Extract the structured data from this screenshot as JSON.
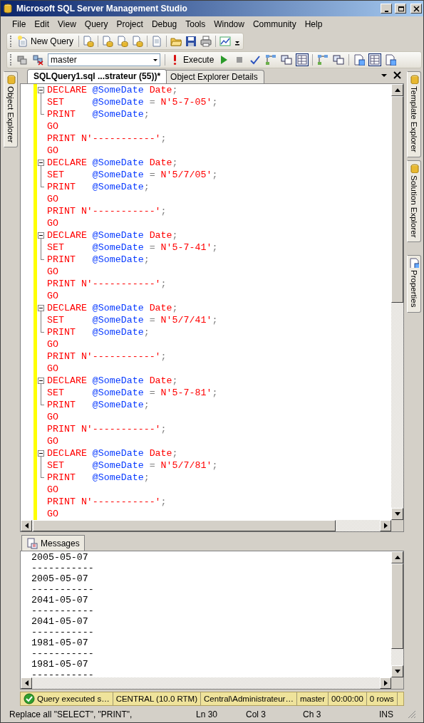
{
  "window": {
    "title": "Microsoft SQL Server Management Studio"
  },
  "menu": [
    "File",
    "Edit",
    "View",
    "Query",
    "Project",
    "Debug",
    "Tools",
    "Window",
    "Community",
    "Help"
  ],
  "toolbar": {
    "new_query": "New Query",
    "database": "master",
    "execute": "Execute"
  },
  "side_tabs_left": [
    "Object Explorer"
  ],
  "side_tabs_right": [
    "Template Explorer",
    "Solution Explorer",
    "Properties"
  ],
  "doc_tabs": [
    {
      "label": "SQLQuery1.sql ...strateur (55))*",
      "selected": true
    },
    {
      "label": "Object Explorer Details",
      "selected": false
    }
  ],
  "code_lines": [
    {
      "expanded": true,
      "tokens": [
        {
          "kind": "keyword",
          "text": "DECLARE "
        },
        {
          "kind": "variable",
          "text": "@SomeDate "
        },
        {
          "kind": "keyword",
          "text": "Date"
        },
        {
          "kind": "punct",
          "text": ";"
        }
      ],
      "children": [
        {
          "tokens": [
            {
              "kind": "keyword",
              "text": "SET     "
            },
            {
              "kind": "variable",
              "text": "@SomeDate "
            },
            {
              "kind": "punct",
              "text": "= "
            },
            {
              "kind": "string",
              "text": "N'5-7-05'"
            },
            {
              "kind": "punct",
              "text": ";"
            }
          ]
        },
        {
          "tokens": [
            {
              "kind": "keyword",
              "text": "PRINT   "
            },
            {
              "kind": "variable",
              "text": "@SomeDate"
            },
            {
              "kind": "punct",
              "text": ";"
            }
          ]
        }
      ]
    },
    {
      "tokens": [
        {
          "kind": "keyword",
          "text": "GO"
        }
      ]
    },
    {
      "tokens": [
        {
          "kind": "keyword",
          "text": "PRINT "
        },
        {
          "kind": "string",
          "text": "N'-----------'"
        },
        {
          "kind": "punct",
          "text": ";"
        }
      ]
    },
    {
      "tokens": [
        {
          "kind": "keyword",
          "text": "GO"
        }
      ]
    },
    {
      "expanded": true,
      "tokens": [
        {
          "kind": "keyword",
          "text": "DECLARE "
        },
        {
          "kind": "variable",
          "text": "@SomeDate "
        },
        {
          "kind": "keyword",
          "text": "Date"
        },
        {
          "kind": "punct",
          "text": ";"
        }
      ],
      "children": [
        {
          "tokens": [
            {
              "kind": "keyword",
              "text": "SET     "
            },
            {
              "kind": "variable",
              "text": "@SomeDate "
            },
            {
              "kind": "punct",
              "text": "= "
            },
            {
              "kind": "string",
              "text": "N'5/7/05'"
            },
            {
              "kind": "punct",
              "text": ";"
            }
          ]
        },
        {
          "tokens": [
            {
              "kind": "keyword",
              "text": "PRINT   "
            },
            {
              "kind": "variable",
              "text": "@SomeDate"
            },
            {
              "kind": "punct",
              "text": ";"
            }
          ]
        }
      ]
    },
    {
      "tokens": [
        {
          "kind": "keyword",
          "text": "GO"
        }
      ]
    },
    {
      "tokens": [
        {
          "kind": "keyword",
          "text": "PRINT "
        },
        {
          "kind": "string",
          "text": "N'-----------'"
        },
        {
          "kind": "punct",
          "text": ";"
        }
      ]
    },
    {
      "tokens": [
        {
          "kind": "keyword",
          "text": "GO"
        }
      ]
    },
    {
      "expanded": true,
      "tokens": [
        {
          "kind": "keyword",
          "text": "DECLARE "
        },
        {
          "kind": "variable",
          "text": "@SomeDate "
        },
        {
          "kind": "keyword",
          "text": "Date"
        },
        {
          "kind": "punct",
          "text": ";"
        }
      ],
      "children": [
        {
          "tokens": [
            {
              "kind": "keyword",
              "text": "SET     "
            },
            {
              "kind": "variable",
              "text": "@SomeDate "
            },
            {
              "kind": "punct",
              "text": "= "
            },
            {
              "kind": "string",
              "text": "N'5-7-41'"
            },
            {
              "kind": "punct",
              "text": ";"
            }
          ]
        },
        {
          "tokens": [
            {
              "kind": "keyword",
              "text": "PRINT   "
            },
            {
              "kind": "variable",
              "text": "@SomeDate"
            },
            {
              "kind": "punct",
              "text": ";"
            }
          ]
        }
      ]
    },
    {
      "tokens": [
        {
          "kind": "keyword",
          "text": "GO"
        }
      ]
    },
    {
      "tokens": [
        {
          "kind": "keyword",
          "text": "PRINT "
        },
        {
          "kind": "string",
          "text": "N'-----------'"
        },
        {
          "kind": "punct",
          "text": ";"
        }
      ]
    },
    {
      "tokens": [
        {
          "kind": "keyword",
          "text": "GO"
        }
      ]
    },
    {
      "expanded": true,
      "tokens": [
        {
          "kind": "keyword",
          "text": "DECLARE "
        },
        {
          "kind": "variable",
          "text": "@SomeDate "
        },
        {
          "kind": "keyword",
          "text": "Date"
        },
        {
          "kind": "punct",
          "text": ";"
        }
      ],
      "children": [
        {
          "tokens": [
            {
              "kind": "keyword",
              "text": "SET     "
            },
            {
              "kind": "variable",
              "text": "@SomeDate "
            },
            {
              "kind": "punct",
              "text": "= "
            },
            {
              "kind": "string",
              "text": "N'5/7/41'"
            },
            {
              "kind": "punct",
              "text": ";"
            }
          ]
        },
        {
          "tokens": [
            {
              "kind": "keyword",
              "text": "PRINT   "
            },
            {
              "kind": "variable",
              "text": "@SomeDate"
            },
            {
              "kind": "punct",
              "text": ";"
            }
          ]
        }
      ]
    },
    {
      "tokens": [
        {
          "kind": "keyword",
          "text": "GO"
        }
      ]
    },
    {
      "tokens": [
        {
          "kind": "keyword",
          "text": "PRINT "
        },
        {
          "kind": "string",
          "text": "N'-----------'"
        },
        {
          "kind": "punct",
          "text": ";"
        }
      ]
    },
    {
      "tokens": [
        {
          "kind": "keyword",
          "text": "GO"
        }
      ]
    },
    {
      "expanded": true,
      "tokens": [
        {
          "kind": "keyword",
          "text": "DECLARE "
        },
        {
          "kind": "variable",
          "text": "@SomeDate "
        },
        {
          "kind": "keyword",
          "text": "Date"
        },
        {
          "kind": "punct",
          "text": ";"
        }
      ],
      "children": [
        {
          "tokens": [
            {
              "kind": "keyword",
              "text": "SET     "
            },
            {
              "kind": "variable",
              "text": "@SomeDate "
            },
            {
              "kind": "punct",
              "text": "= "
            },
            {
              "kind": "string",
              "text": "N'5-7-81'"
            },
            {
              "kind": "punct",
              "text": ";"
            }
          ]
        },
        {
          "tokens": [
            {
              "kind": "keyword",
              "text": "PRINT   "
            },
            {
              "kind": "variable",
              "text": "@SomeDate"
            },
            {
              "kind": "punct",
              "text": ";"
            }
          ]
        }
      ]
    },
    {
      "tokens": [
        {
          "kind": "keyword",
          "text": "GO"
        }
      ]
    },
    {
      "tokens": [
        {
          "kind": "keyword",
          "text": "PRINT "
        },
        {
          "kind": "string",
          "text": "N'-----------'"
        },
        {
          "kind": "punct",
          "text": ";"
        }
      ]
    },
    {
      "tokens": [
        {
          "kind": "keyword",
          "text": "GO"
        }
      ]
    },
    {
      "expanded": true,
      "tokens": [
        {
          "kind": "keyword",
          "text": "DECLARE "
        },
        {
          "kind": "variable",
          "text": "@SomeDate "
        },
        {
          "kind": "keyword",
          "text": "Date"
        },
        {
          "kind": "punct",
          "text": ";"
        }
      ],
      "children": [
        {
          "tokens": [
            {
              "kind": "keyword",
              "text": "SET     "
            },
            {
              "kind": "variable",
              "text": "@SomeDate "
            },
            {
              "kind": "punct",
              "text": "= "
            },
            {
              "kind": "string",
              "text": "N'5/7/81'"
            },
            {
              "kind": "punct",
              "text": ";"
            }
          ]
        },
        {
          "tokens": [
            {
              "kind": "keyword",
              "text": "PRINT   "
            },
            {
              "kind": "variable",
              "text": "@SomeDate"
            },
            {
              "kind": "punct",
              "text": ";"
            }
          ]
        }
      ]
    },
    {
      "tokens": [
        {
          "kind": "keyword",
          "text": "GO"
        }
      ]
    },
    {
      "tokens": [
        {
          "kind": "keyword",
          "text": "PRINT "
        },
        {
          "kind": "string",
          "text": "N'-----------'"
        },
        {
          "kind": "punct",
          "text": ";"
        }
      ]
    },
    {
      "tokens": [
        {
          "kind": "keyword",
          "text": "GO"
        }
      ]
    }
  ],
  "results_tab": "Messages",
  "messages": [
    "2005-05-07",
    "-----------",
    "2005-05-07",
    "-----------",
    "2041-05-07",
    "-----------",
    "2041-05-07",
    "-----------",
    "1981-05-07",
    "-----------",
    "1981-05-07",
    "-----------"
  ],
  "query_status": [
    {
      "kind": "success",
      "text": "Query executed s…"
    },
    {
      "text": "CENTRAL (10.0 RTM)"
    },
    {
      "text": "Central\\Administrateur…"
    },
    {
      "text": "master"
    },
    {
      "text": "00:00:00"
    },
    {
      "text": "0 rows"
    }
  ],
  "status_bar": {
    "message": "Replace all \"SELECT\", \"PRINT\",",
    "line": "Ln 30",
    "column": "Col 3",
    "char": "Ch 3",
    "mode": "INS"
  }
}
